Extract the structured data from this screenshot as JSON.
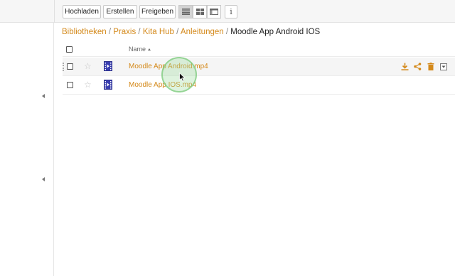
{
  "toolbar": {
    "upload_label": "Hochladen",
    "create_label": "Erstellen",
    "share_label": "Freigeben",
    "view_list_icon": "list-view-icon",
    "view_grid_icon": "grid-view-icon",
    "view_detail_icon": "detail-view-icon",
    "info_label": "i"
  },
  "breadcrumb": {
    "items": [
      "Bibliotheken",
      "Praxis",
      "Kita Hub",
      "Anleitungen"
    ],
    "separator": "/",
    "current": "Moodle App Android IOS"
  },
  "list": {
    "name_header": "Name",
    "rows": [
      {
        "name": "Moodle App Android.mp4",
        "starred": false,
        "icon": "video-file-icon"
      },
      {
        "name": "Moodle App IOS.mp4",
        "starred": false,
        "icon": "video-file-icon"
      }
    ]
  },
  "colors": {
    "accent": "#d4891a",
    "toolbar_bg": "#f6f6f6",
    "row_hover": "#f5f5f5",
    "video_icon": "#3a3fb0"
  }
}
